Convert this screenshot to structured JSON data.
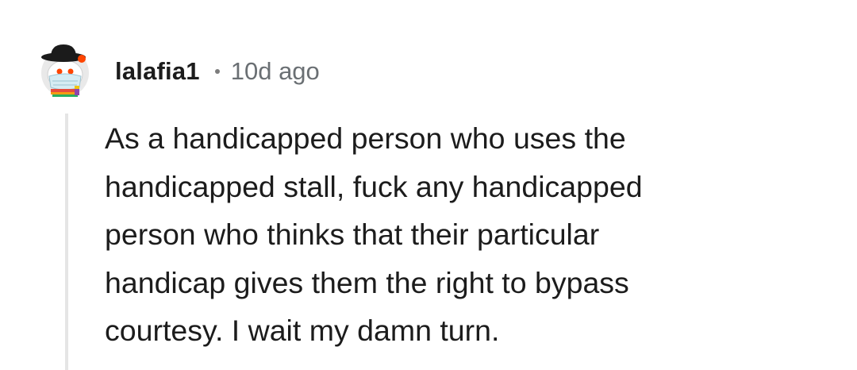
{
  "comment": {
    "author": {
      "username": "lalafia1",
      "avatar_icon": "snoo-avatar-icon"
    },
    "separator": "•",
    "timestamp": "10d ago",
    "body_lines": [
      "As a handicapped person who uses the",
      "handicapped stall, fuck any handicapped",
      "person who thinks that their particular",
      "handicap gives them the right to bypass",
      "courtesy. I wait my damn turn."
    ]
  },
  "colors": {
    "text": "#1c1c1c",
    "meta_text": "#6a6f73",
    "thread_line": "#e5e5e5",
    "background": "#ffffff"
  }
}
